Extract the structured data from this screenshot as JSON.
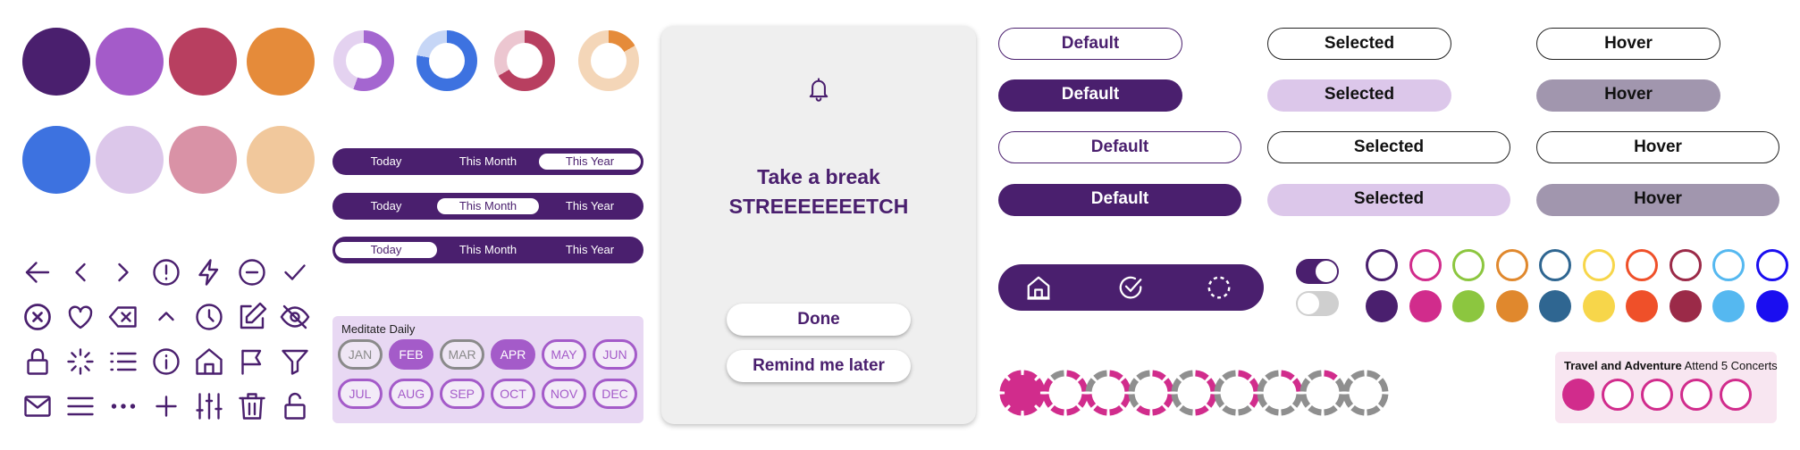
{
  "palette": {
    "row1": [
      "#4a1f6e",
      "#a45bc9",
      "#b83f60",
      "#e58b3a"
    ],
    "row2": [
      "#3d72e0",
      "#dcc7ea",
      "#d992a6",
      "#f1c89c"
    ]
  },
  "loaders": [
    {
      "name": "purple",
      "color": "#a466d0",
      "track": "#e4d2f0"
    },
    {
      "name": "blue",
      "color": "#3d72e0",
      "track": "#c6d6f6"
    },
    {
      "name": "red",
      "color": "#b83f60",
      "track": "#ecc6d0"
    },
    {
      "name": "orange",
      "color": "#e58b3a",
      "track": "#f4d6b8"
    }
  ],
  "segments": {
    "rows": [
      {
        "options": [
          "Today",
          "This Month",
          "This Year"
        ],
        "selected": 2
      },
      {
        "options": [
          "Today",
          "This Month",
          "This Year"
        ],
        "selected": 1
      },
      {
        "options": [
          "Today",
          "This Month",
          "This Year"
        ],
        "selected": 0
      }
    ]
  },
  "months_card": {
    "title": "Meditate Daily",
    "months": [
      {
        "label": "JAN",
        "state": "gray"
      },
      {
        "label": "FEB",
        "state": "filled"
      },
      {
        "label": "MAR",
        "state": "gray"
      },
      {
        "label": "APR",
        "state": "filled"
      },
      {
        "label": "MAY",
        "state": "outline"
      },
      {
        "label": "JUN",
        "state": "outline"
      },
      {
        "label": "JUL",
        "state": "outline"
      },
      {
        "label": "AUG",
        "state": "outline"
      },
      {
        "label": "SEP",
        "state": "outline"
      },
      {
        "label": "OCT",
        "state": "outline"
      },
      {
        "label": "NOV",
        "state": "outline"
      },
      {
        "label": "DEC",
        "state": "outline"
      }
    ]
  },
  "notification": {
    "icon": "bell-icon",
    "title_line1": "Take a break",
    "title_line2": "STREEEEEEETCH",
    "done_label": "Done",
    "remind_label": "Remind me later"
  },
  "buttons": {
    "default_label": "Default",
    "selected_label": "Selected",
    "hover_label": "Hover"
  },
  "navbar": {
    "items": [
      "home-icon",
      "check-circle-icon",
      "loading-circle-icon"
    ]
  },
  "toggles": {
    "on": true,
    "off": false
  },
  "color_swatches": [
    "#4a1f6e",
    "#d12c8c",
    "#8cc63f",
    "#e0882d",
    "#2f6691",
    "#f7d64a",
    "#ef5029",
    "#9b2a48",
    "#55b8f0",
    "#1a0ef0"
  ],
  "progress_rings": [
    8,
    7,
    6,
    5,
    4,
    3,
    2,
    1,
    0
  ],
  "travel_card": {
    "title_bold": "Travel and Adventure",
    "title_rest": " Attend 5 Concerts",
    "total": 5,
    "done": 1
  },
  "icons": [
    "arrow-left-icon",
    "chevron-left-icon",
    "chevron-right-icon",
    "alert-circle-icon",
    "lightning-icon",
    "minus-circle-icon",
    "check-icon",
    "x-circle-icon",
    "heart-icon",
    "backspace-icon",
    "chevron-up-icon",
    "clock-icon",
    "edit-icon",
    "eye-off-icon",
    "lock-icon",
    "loader-icon",
    "list-icon",
    "info-icon",
    "home-icon",
    "flag-icon",
    "filter-icon",
    "mail-icon",
    "menu-icon",
    "more-horizontal-icon",
    "plus-icon",
    "sliders-icon",
    "trash-icon",
    "unlock-icon"
  ]
}
